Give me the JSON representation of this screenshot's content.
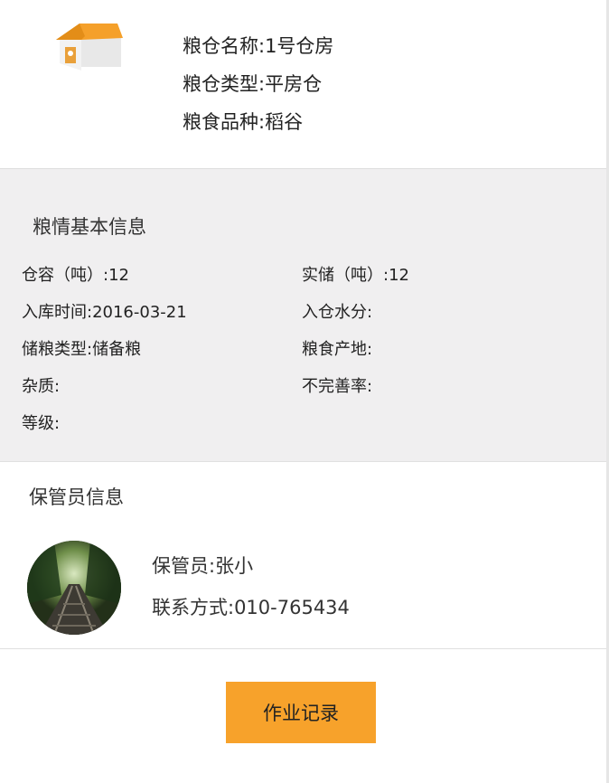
{
  "granary": {
    "name_line": "粮仓名称:1号仓房",
    "type_line": "粮仓类型:平房仓",
    "variety_line": "粮食品种:稻谷"
  },
  "basic_info": {
    "title": "粮情基本信息",
    "rows": [
      {
        "left": "仓容（吨）:12",
        "right": "实储（吨）:12"
      },
      {
        "left": "入库时间:2016-03-21",
        "right": "入仓水分:"
      },
      {
        "left": "储粮类型:储备粮",
        "right": "粮食产地:"
      },
      {
        "left": "杂质:",
        "right": "不完善率:"
      },
      {
        "left": "等级:",
        "right": ""
      }
    ]
  },
  "keeper": {
    "title": "保管员信息",
    "name_line": "保管员:张小",
    "contact_line": "联系方式:010-765434"
  },
  "actions": {
    "records_label": "作业记录"
  },
  "colors": {
    "accent": "#f7a22b",
    "panel_bg": "#f0eff0",
    "house_roof": "#f5a02a"
  },
  "icons": {
    "granary": "warehouse-icon"
  }
}
